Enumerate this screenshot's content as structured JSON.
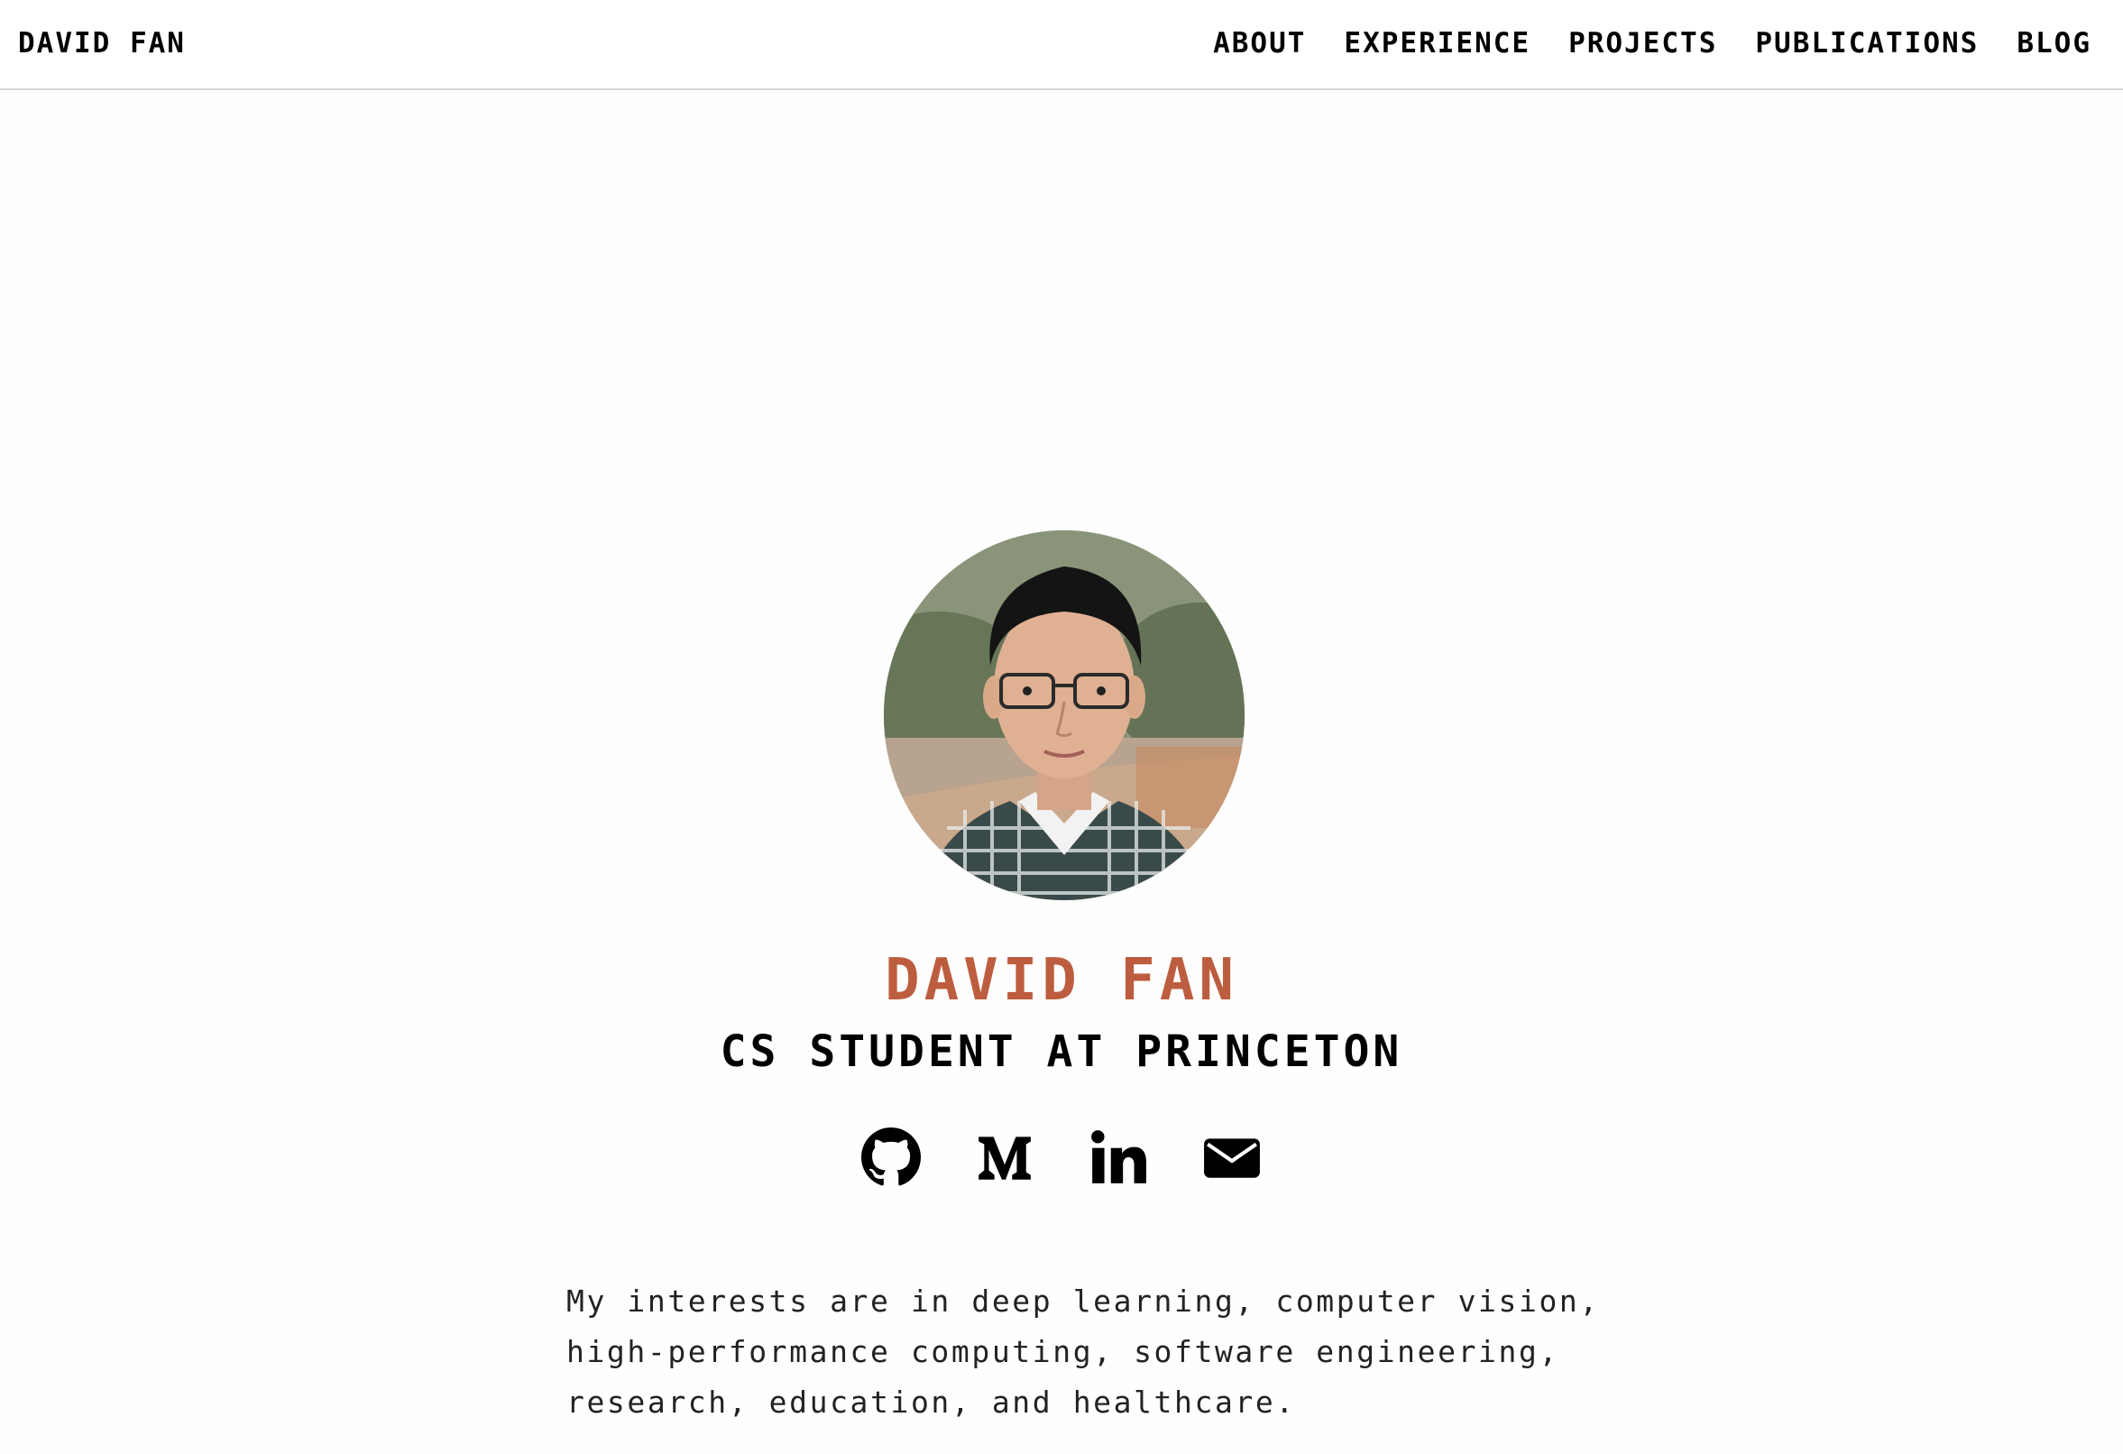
{
  "nav": {
    "brand": "DAVID FAN",
    "links": [
      "ABOUT",
      "EXPERIENCE",
      "PROJECTS",
      "PUBLICATIONS",
      "BLOG"
    ]
  },
  "hero": {
    "name": "DAVID FAN",
    "subtitle": "CS STUDENT AT PRINCETON",
    "accent_color": "#bd5d3f",
    "socials": [
      {
        "icon": "github-icon"
      },
      {
        "icon": "medium-icon"
      },
      {
        "icon": "linkedin-icon"
      },
      {
        "icon": "email-icon"
      }
    ],
    "bio": "My interests are in deep learning, computer vision, high-performance computing, software engineering, research, education, and healthcare."
  }
}
